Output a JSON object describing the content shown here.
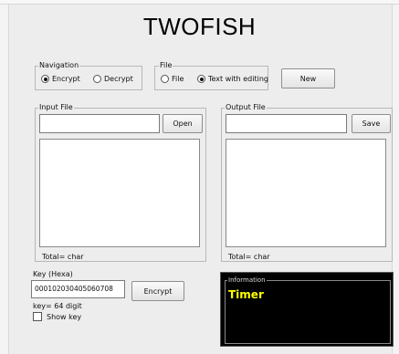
{
  "title": "TWOFISH",
  "navigation": {
    "legend": "Navigation",
    "options": [
      "Encrypt",
      "Decrypt"
    ],
    "selected": "Encrypt"
  },
  "file_group": {
    "legend": "File",
    "options": [
      "File",
      "Text with editing"
    ],
    "selected": "Text with editing"
  },
  "new_button": "New",
  "input_panel": {
    "legend": "Input File",
    "path_value": "",
    "open_button": "Open",
    "text_value": "",
    "total_label": "Total= char"
  },
  "output_panel": {
    "legend": "Output File",
    "path_value": "",
    "save_button": "Save",
    "text_value": "",
    "total_label": "Total= char"
  },
  "key": {
    "label": "Key (Hexa)",
    "value": "000102030405060708",
    "length_label": "key= 64 digit",
    "show_key_label": "Show key",
    "show_key_checked": false
  },
  "encrypt_button": "Encrypt",
  "information": {
    "legend": "Information",
    "message": "Timer",
    "message_color": "#ffff00"
  }
}
